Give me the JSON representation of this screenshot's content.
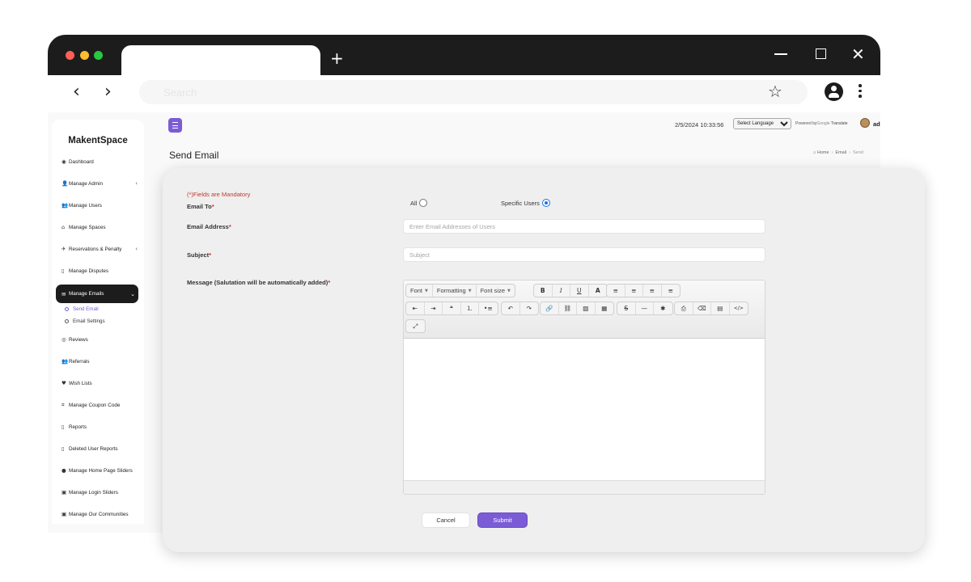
{
  "browser": {
    "new_tab_icon": "+",
    "search_placeholder": "Search"
  },
  "app": {
    "brand": "MakentSpace",
    "datetime": "2/5/2024 10:33:56",
    "language_select": "Select Language",
    "powered_by": "Powered by",
    "google": "Google",
    "translate": "Translate",
    "user": "ad"
  },
  "sidebar": {
    "items": [
      {
        "label": "Dashboard",
        "icon": "dashboard-icon"
      },
      {
        "label": "Manage Admin",
        "icon": "user-plus-icon",
        "chevron": "‹"
      },
      {
        "label": "Manage Users",
        "icon": "users-icon"
      },
      {
        "label": "Manage Spaces",
        "icon": "home-icon"
      },
      {
        "label": "Reservations & Penalty",
        "icon": "plane-icon",
        "chevron": "‹"
      },
      {
        "label": "Manage Disputes",
        "icon": "file-icon"
      },
      {
        "label": "Manage Emails",
        "icon": "envelope-icon",
        "chevron": "⌄",
        "active": true
      },
      {
        "label": "Reviews",
        "icon": "eye-icon"
      },
      {
        "label": "Referrals",
        "icon": "users-icon"
      },
      {
        "label": "Wish Lists",
        "icon": "heart-icon"
      },
      {
        "label": "Manage Coupon Code",
        "icon": "tag-icon"
      },
      {
        "label": "Reports",
        "icon": "file-icon"
      },
      {
        "label": "Deleted User Reports",
        "icon": "file-icon"
      },
      {
        "label": "Manage Home Page Sliders",
        "icon": "globe-icon"
      },
      {
        "label": "Manage Login Sliders",
        "icon": "image-icon"
      },
      {
        "label": "Manage Our Communities",
        "icon": "image-icon"
      }
    ],
    "email_subitems": [
      "Send Email",
      "Email Settings"
    ]
  },
  "page": {
    "title": "Send Email",
    "breadcrumb": [
      "Home",
      "Email",
      "Send"
    ]
  },
  "form": {
    "mandatory_note": "(*)Fields are Mandatory",
    "email_to_label": "Email To",
    "radio_all": "All",
    "radio_specific": "Specific Users",
    "email_address_label": "Email Address",
    "email_address_placeholder": "Enter Email Addresses of Users",
    "subject_label": "Subject",
    "subject_placeholder": "Subject",
    "message_label": "Message (Salutation will be automatically added)",
    "required_mark": "*",
    "cancel": "Cancel",
    "submit": "Submit"
  },
  "editor": {
    "dropdowns": [
      "Font",
      "Formatting",
      "Font size"
    ],
    "buttons": {
      "bold": "B",
      "italic": "I",
      "underline": "U",
      "text_color": "A",
      "align_left": "≡",
      "align_center": "≡",
      "align_right": "≡",
      "justify": "≡",
      "outdent": "⇤",
      "indent": "⇥",
      "blockquote": "❝",
      "numbered_list": "⒈",
      "bullet_list": "•≡",
      "undo": "↶",
      "redo": "↷",
      "link": "🔗",
      "unlink": "⛓",
      "image": "▨",
      "table": "▦",
      "strikethrough": "S",
      "horizontal_rule": "—",
      "special_char": "✱",
      "print": "⎙",
      "remove_format": "⌫",
      "source_doc": "▤",
      "source": "</>",
      "maximize": "⤢"
    }
  },
  "colors": {
    "accent": "#7b5cd6",
    "required": "#d32f2f",
    "mandatory_note": "#c0392b",
    "radio_selected": "#1a73e8",
    "sidebar_active": "#1c1c1c"
  }
}
